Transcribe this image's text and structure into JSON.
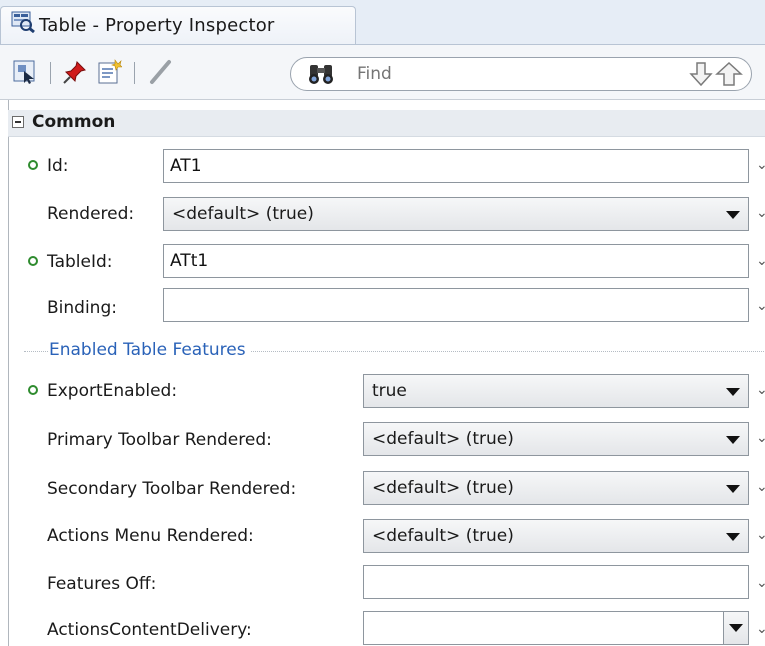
{
  "tab": {
    "title": "Table - Property Inspector",
    "icon": "property-inspector-icon"
  },
  "toolbar": {
    "buttons": [
      "select-in-structure-icon",
      "pin-icon",
      "edit-icon",
      "pencil-icon"
    ],
    "search": {
      "placeholder": "Find",
      "value": ""
    },
    "nav": {
      "down": "find-next-icon",
      "up": "find-previous-icon"
    }
  },
  "section": {
    "title": "Common",
    "expanded": true
  },
  "fields": {
    "id": {
      "label": "Id:",
      "value": "AT1",
      "modified": true
    },
    "rendered": {
      "label": "Rendered:",
      "value": "<default> (true)"
    },
    "tableId": {
      "label": "TableId:",
      "value": "ATt1",
      "modified": true
    },
    "binding": {
      "label": "Binding:",
      "value": ""
    }
  },
  "group": {
    "title": "Enabled Table Features"
  },
  "features": {
    "exportEnabled": {
      "label": "ExportEnabled:",
      "value": "true",
      "modified": true
    },
    "primaryToolbar": {
      "label": "Primary Toolbar Rendered:",
      "value": "<default> (true)"
    },
    "secondaryToolbar": {
      "label": "Secondary Toolbar Rendered:",
      "value": "<default> (true)"
    },
    "actionsMenu": {
      "label": "Actions Menu Rendered:",
      "value": "<default> (true)"
    },
    "featuresOff": {
      "label": "Features Off:",
      "value": ""
    },
    "actionsContentDelivery": {
      "label": "ActionsContentDelivery:",
      "value": ""
    }
  },
  "colors": {
    "accent": "#2a62b8",
    "modified_dot": "#2e8b2e",
    "tab_bg": "#e6edf6"
  }
}
